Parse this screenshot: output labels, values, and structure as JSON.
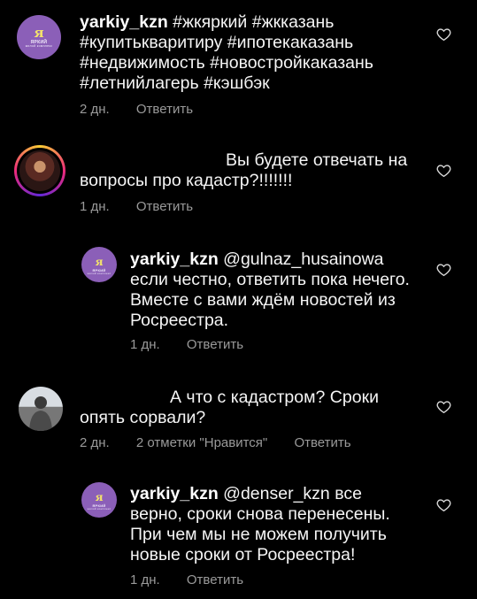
{
  "comments": [
    {
      "username": "yarkiy_kzn",
      "text": "#жкяркий #жкказань #купитькваритиру #ипотекаказань #недвижимость #новостройкаказань #летнийлагерь #кэшбэк",
      "time": "2 дн.",
      "reply_label": "Ответить",
      "avatar": {
        "line1": "я",
        "line2": "ЯРКИЙ",
        "line3": "жилой комплекс"
      }
    },
    {
      "username": "",
      "text": "Вы будете отвечать на вопросы про кадастр?!!!!!!!",
      "time": "1 дн.",
      "reply_label": "Ответить"
    },
    {
      "username": "yarkiy_kzn",
      "text": "@gulnaz_husainowa если честно, ответить пока нечего. Вместе с вами ждём новостей из Росреестра.",
      "time": "1 дн.",
      "reply_label": "Ответить",
      "avatar": {
        "line1": "я",
        "line2": "ЯРКИЙ",
        "line3": "жилой комплекс"
      }
    },
    {
      "username": "",
      "text": "А что с кадастром? Сроки опять сорвали?",
      "time": "2 дн.",
      "likes": "2 отметки \"Нравится\"",
      "reply_label": "Ответить"
    },
    {
      "username": "yarkiy_kzn",
      "text": "@denser_kzn все верно, сроки снова перенесены. При чем мы не можем получить новые сроки от Росреестра!",
      "time": "1 дн.",
      "reply_label": "Ответить",
      "avatar": {
        "line1": "я",
        "line2": "ЯРКИЙ",
        "line3": "жилой комплекс"
      }
    }
  ],
  "icons": {
    "like": "heart-outline-icon"
  },
  "colors": {
    "background": "#000000",
    "text": "#f5f5f5",
    "meta": "#9a9a9a",
    "brand": "#8b5fb8"
  }
}
